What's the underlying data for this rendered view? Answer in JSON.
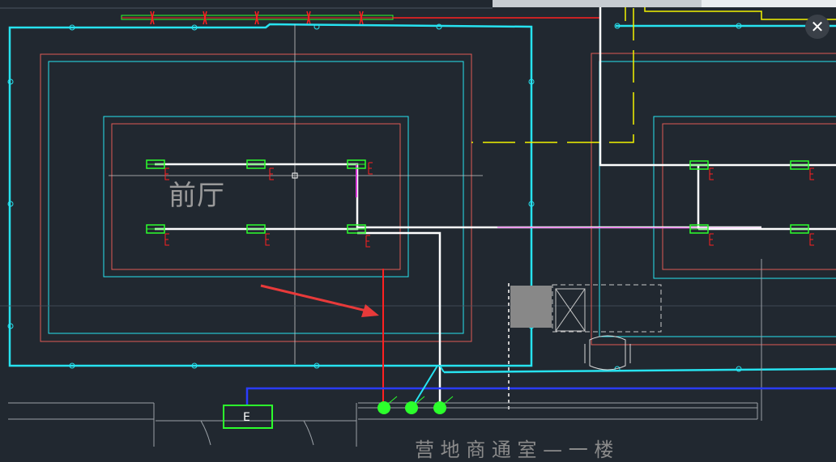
{
  "drawing": {
    "room_label": "前厅",
    "bottom_label": "营 地 商 通 室 — 一 楼",
    "panel_label": "E",
    "fixture_tag": "E"
  },
  "viewer": {
    "close_label": "✕"
  },
  "colors": {
    "background": "#212830",
    "wall_cyan": "#27e3f0",
    "wall_red": "#e05a55",
    "wire_white": "#ffffff",
    "wire_red": "#ff2020",
    "wire_blue": "#2a3cff",
    "wire_yellow": "#f2f200",
    "wire_magenta": "#e040e0",
    "fixture_green": "#2cff2c",
    "annotation_arrow": "#e83a3a"
  }
}
